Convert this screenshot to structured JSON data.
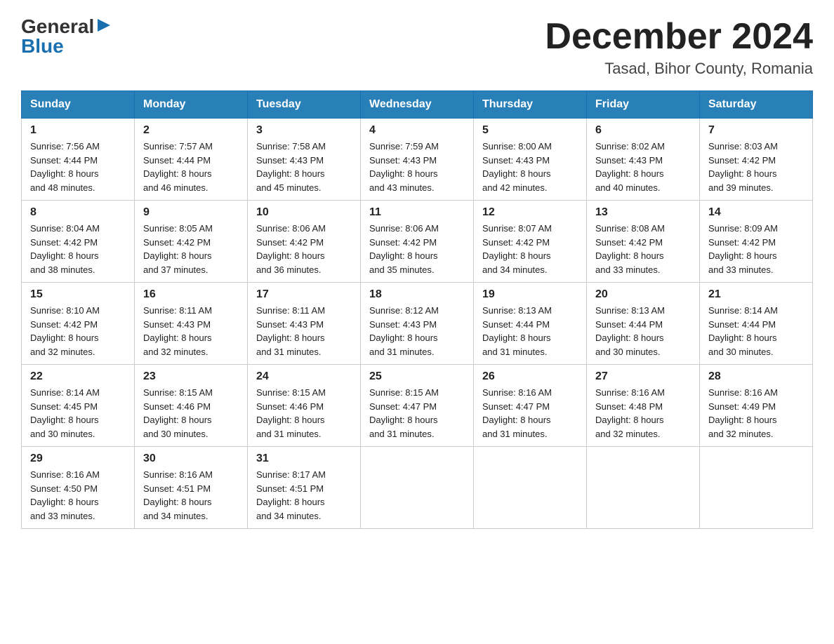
{
  "logo": {
    "general": "General",
    "blue": "Blue",
    "arrow": "▶"
  },
  "title": "December 2024",
  "location": "Tasad, Bihor County, Romania",
  "weekdays": [
    "Sunday",
    "Monday",
    "Tuesday",
    "Wednesday",
    "Thursday",
    "Friday",
    "Saturday"
  ],
  "weeks": [
    [
      {
        "day": "1",
        "sunrise": "7:56 AM",
        "sunset": "4:44 PM",
        "daylight": "8 hours and 48 minutes."
      },
      {
        "day": "2",
        "sunrise": "7:57 AM",
        "sunset": "4:44 PM",
        "daylight": "8 hours and 46 minutes."
      },
      {
        "day": "3",
        "sunrise": "7:58 AM",
        "sunset": "4:43 PM",
        "daylight": "8 hours and 45 minutes."
      },
      {
        "day": "4",
        "sunrise": "7:59 AM",
        "sunset": "4:43 PM",
        "daylight": "8 hours and 43 minutes."
      },
      {
        "day": "5",
        "sunrise": "8:00 AM",
        "sunset": "4:43 PM",
        "daylight": "8 hours and 42 minutes."
      },
      {
        "day": "6",
        "sunrise": "8:02 AM",
        "sunset": "4:43 PM",
        "daylight": "8 hours and 40 minutes."
      },
      {
        "day": "7",
        "sunrise": "8:03 AM",
        "sunset": "4:42 PM",
        "daylight": "8 hours and 39 minutes."
      }
    ],
    [
      {
        "day": "8",
        "sunrise": "8:04 AM",
        "sunset": "4:42 PM",
        "daylight": "8 hours and 38 minutes."
      },
      {
        "day": "9",
        "sunrise": "8:05 AM",
        "sunset": "4:42 PM",
        "daylight": "8 hours and 37 minutes."
      },
      {
        "day": "10",
        "sunrise": "8:06 AM",
        "sunset": "4:42 PM",
        "daylight": "8 hours and 36 minutes."
      },
      {
        "day": "11",
        "sunrise": "8:06 AM",
        "sunset": "4:42 PM",
        "daylight": "8 hours and 35 minutes."
      },
      {
        "day": "12",
        "sunrise": "8:07 AM",
        "sunset": "4:42 PM",
        "daylight": "8 hours and 34 minutes."
      },
      {
        "day": "13",
        "sunrise": "8:08 AM",
        "sunset": "4:42 PM",
        "daylight": "8 hours and 33 minutes."
      },
      {
        "day": "14",
        "sunrise": "8:09 AM",
        "sunset": "4:42 PM",
        "daylight": "8 hours and 33 minutes."
      }
    ],
    [
      {
        "day": "15",
        "sunrise": "8:10 AM",
        "sunset": "4:42 PM",
        "daylight": "8 hours and 32 minutes."
      },
      {
        "day": "16",
        "sunrise": "8:11 AM",
        "sunset": "4:43 PM",
        "daylight": "8 hours and 32 minutes."
      },
      {
        "day": "17",
        "sunrise": "8:11 AM",
        "sunset": "4:43 PM",
        "daylight": "8 hours and 31 minutes."
      },
      {
        "day": "18",
        "sunrise": "8:12 AM",
        "sunset": "4:43 PM",
        "daylight": "8 hours and 31 minutes."
      },
      {
        "day": "19",
        "sunrise": "8:13 AM",
        "sunset": "4:44 PM",
        "daylight": "8 hours and 31 minutes."
      },
      {
        "day": "20",
        "sunrise": "8:13 AM",
        "sunset": "4:44 PM",
        "daylight": "8 hours and 30 minutes."
      },
      {
        "day": "21",
        "sunrise": "8:14 AM",
        "sunset": "4:44 PM",
        "daylight": "8 hours and 30 minutes."
      }
    ],
    [
      {
        "day": "22",
        "sunrise": "8:14 AM",
        "sunset": "4:45 PM",
        "daylight": "8 hours and 30 minutes."
      },
      {
        "day": "23",
        "sunrise": "8:15 AM",
        "sunset": "4:46 PM",
        "daylight": "8 hours and 30 minutes."
      },
      {
        "day": "24",
        "sunrise": "8:15 AM",
        "sunset": "4:46 PM",
        "daylight": "8 hours and 31 minutes."
      },
      {
        "day": "25",
        "sunrise": "8:15 AM",
        "sunset": "4:47 PM",
        "daylight": "8 hours and 31 minutes."
      },
      {
        "day": "26",
        "sunrise": "8:16 AM",
        "sunset": "4:47 PM",
        "daylight": "8 hours and 31 minutes."
      },
      {
        "day": "27",
        "sunrise": "8:16 AM",
        "sunset": "4:48 PM",
        "daylight": "8 hours and 32 minutes."
      },
      {
        "day": "28",
        "sunrise": "8:16 AM",
        "sunset": "4:49 PM",
        "daylight": "8 hours and 32 minutes."
      }
    ],
    [
      {
        "day": "29",
        "sunrise": "8:16 AM",
        "sunset": "4:50 PM",
        "daylight": "8 hours and 33 minutes."
      },
      {
        "day": "30",
        "sunrise": "8:16 AM",
        "sunset": "4:51 PM",
        "daylight": "8 hours and 34 minutes."
      },
      {
        "day": "31",
        "sunrise": "8:17 AM",
        "sunset": "4:51 PM",
        "daylight": "8 hours and 34 minutes."
      },
      null,
      null,
      null,
      null
    ]
  ],
  "labels": {
    "sunrise": "Sunrise:",
    "sunset": "Sunset:",
    "daylight": "Daylight:"
  }
}
